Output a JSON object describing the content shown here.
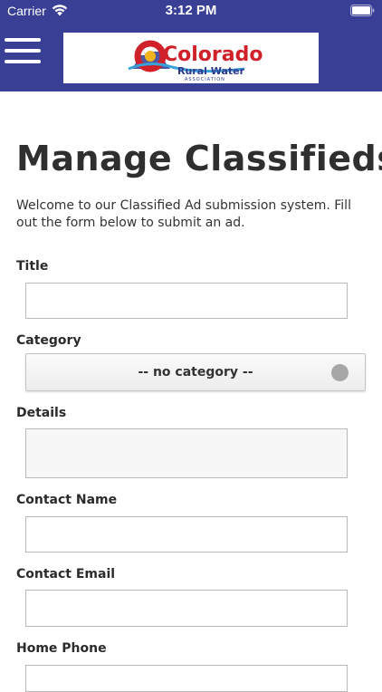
{
  "status_bar": {
    "carrier": "Carrier",
    "time": "3:12 PM"
  },
  "header": {
    "menu_icon": "hamburger-menu-icon",
    "logo": {
      "line1": "Colorado",
      "line2": "Rural Water",
      "line3": "ASSOCIATION"
    },
    "colors": {
      "header_bg": "#3a3f96",
      "logo_red": "#d0202a",
      "logo_blue": "#2f3a8f",
      "logo_gold": "#f2b41c"
    }
  },
  "page": {
    "title": "Manage Classifieds",
    "intro": "Welcome to our Classified Ad submission system. Fill out the form below to submit an ad."
  },
  "form": {
    "title_label": "Title",
    "title_value": "",
    "category_label": "Category",
    "category_selected": "-- no category --",
    "details_label": "Details",
    "details_value": "",
    "contact_name_label": "Contact Name",
    "contact_name_value": "",
    "contact_email_label": "Contact Email",
    "contact_email_value": "",
    "home_phone_label": "Home Phone",
    "home_phone_value": ""
  }
}
